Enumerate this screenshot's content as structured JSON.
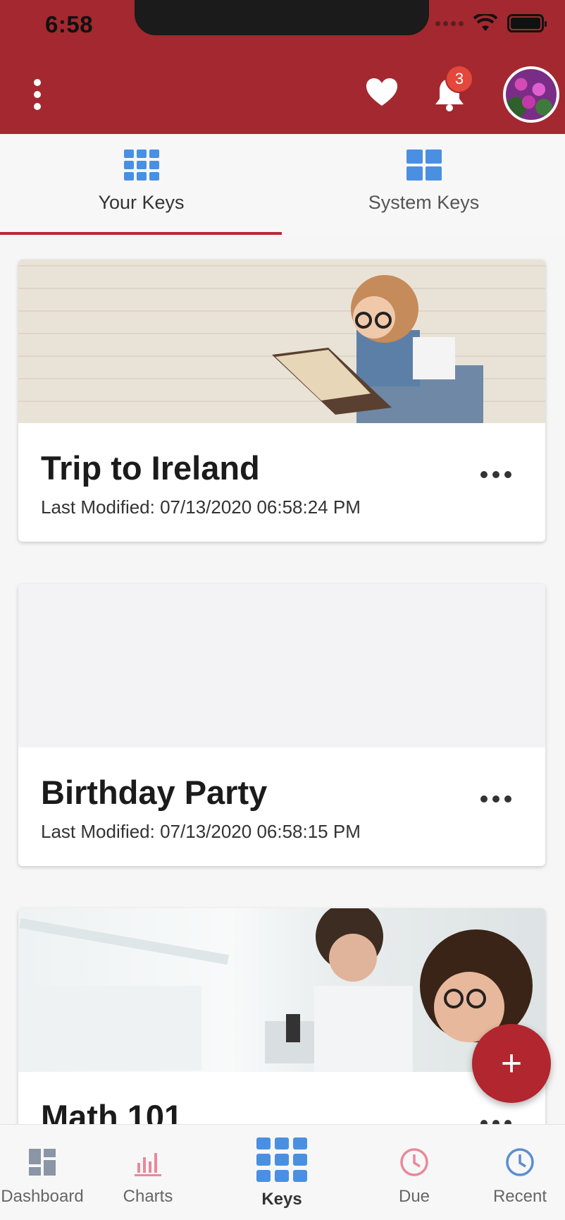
{
  "status_bar": {
    "time": "6:58"
  },
  "header": {
    "menu_icon": "more-vertical-icon",
    "favorites_icon": "heart-icon",
    "notifications_icon": "bell-icon",
    "notification_count": "3",
    "avatar": "user-avatar"
  },
  "tabs": [
    {
      "label": "Your Keys",
      "icon": "grid-icon",
      "active": true
    },
    {
      "label": "System Keys",
      "icon": "dashboard-grid-icon",
      "active": false
    }
  ],
  "cards": [
    {
      "title": "Trip to Ireland",
      "meta": "Last Modified: 07/13/2020 06:58:24 PM",
      "image": "girl-reading-photo"
    },
    {
      "title": "Birthday Party",
      "meta": "Last Modified: 07/13/2020 06:58:15 PM",
      "image": "empty-placeholder"
    },
    {
      "title": "Math 101",
      "meta": "",
      "image": "lab-scientists-photo"
    }
  ],
  "fab": {
    "label": "+"
  },
  "bottom_nav": [
    {
      "label": "Dashboard",
      "icon": "dashboard-icon"
    },
    {
      "label": "Charts",
      "icon": "bar-chart-icon"
    },
    {
      "label": "Keys",
      "icon": "grid-icon",
      "active": true
    },
    {
      "label": "Due",
      "icon": "clock-icon"
    },
    {
      "label": "Recent",
      "icon": "clock-icon"
    }
  ],
  "colors": {
    "brand": "#a4282f",
    "accent_blue": "#4a90e2",
    "badge": "#e4473c",
    "due_icon": "#e8899a"
  }
}
